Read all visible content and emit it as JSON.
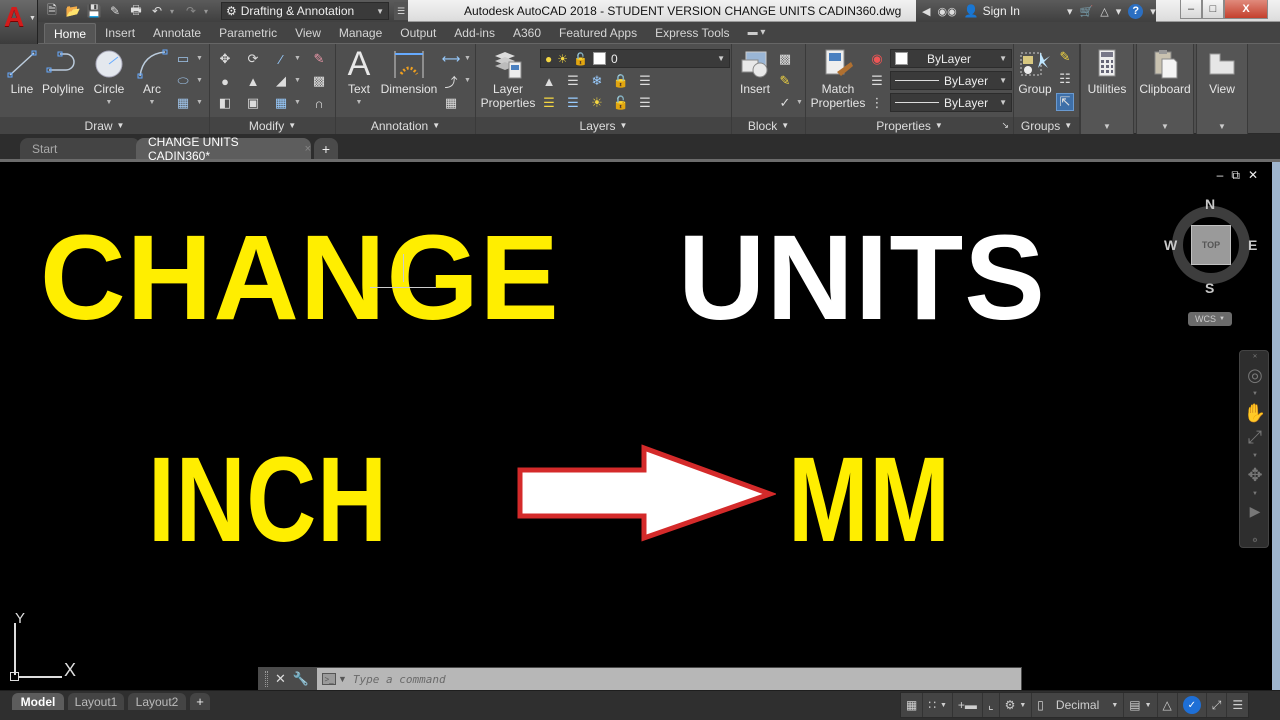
{
  "app": {
    "logo_letter": "A",
    "window_title": "Autodesk AutoCAD 2018 - STUDENT VERSION    CHANGE UNITS CADIN360.dwg"
  },
  "quick_access": {
    "workspace": "Drafting & Annotation",
    "buttons": [
      "new-icon",
      "open-icon",
      "save-icon",
      "save-as-icon",
      "plot-icon",
      "undo-icon",
      "redo-icon"
    ]
  },
  "infocenter": {
    "sign_in": "Sign In",
    "help": "?"
  },
  "window_controls": {
    "minimize": "–",
    "maximize": "□",
    "close": "X"
  },
  "ribbon_tabs": [
    "Home",
    "Insert",
    "Annotate",
    "Parametric",
    "View",
    "Manage",
    "Output",
    "Add-ins",
    "A360",
    "Featured Apps",
    "Express Tools"
  ],
  "ribbon_tabs_active": "Home",
  "ribbon": {
    "draw": {
      "title": "Draw",
      "line": "Line",
      "polyline": "Polyline",
      "circle": "Circle",
      "arc": "Arc"
    },
    "modify": {
      "title": "Modify"
    },
    "annotation": {
      "title": "Annotation",
      "text": "Text",
      "dimension": "Dimension"
    },
    "layers": {
      "title": "Layers",
      "layer_properties_1": "Layer",
      "layer_properties_2": "Properties",
      "current_layer": "0"
    },
    "block": {
      "title": "Block",
      "insert": "Insert"
    },
    "properties": {
      "title": "Properties",
      "match_1": "Match",
      "match_2": "Properties",
      "color": "ByLayer",
      "linetype": "ByLayer",
      "lineweight": "ByLayer"
    },
    "groups": {
      "title": "Groups",
      "group": "Group"
    },
    "utilities": "Utilities",
    "clipboard": "Clipboard",
    "view": "View"
  },
  "file_tabs": {
    "start": "Start",
    "current": "CHANGE UNITS CADIN360*",
    "close": "×",
    "add": "+"
  },
  "canvas": {
    "headline_word1": "CHANGE",
    "headline_word2": "UNITS",
    "from_unit": "INCH",
    "to_unit": "MM",
    "colors": {
      "yellow": "#ffee00",
      "white": "#ffffff",
      "arrow_outline": "#d42a2a",
      "background": "#000000"
    }
  },
  "viewport_controls": {
    "minimize": "‒",
    "restore": "⧉",
    "close": "✕"
  },
  "viewcube": {
    "face": "TOP",
    "north": "N",
    "south": "S",
    "east": "E",
    "west": "W",
    "ucs": "WCS"
  },
  "ucs_icon": {
    "x": "X",
    "y": "Y"
  },
  "command_line": {
    "placeholder": "Type a command",
    "close": "✕"
  },
  "layout_tabs": {
    "model": "Model",
    "layout1": "Layout1",
    "layout2": "Layout2",
    "add": "+"
  },
  "status_bar": {
    "units": "Decimal"
  }
}
